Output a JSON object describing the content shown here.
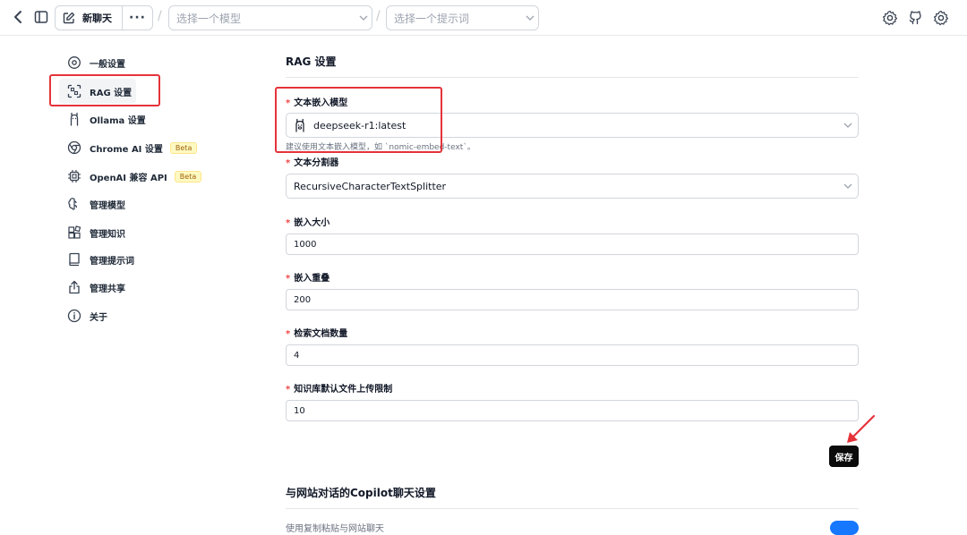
{
  "topbar": {
    "new_chat_label": "新聊天",
    "more_label": "···",
    "slash": "/",
    "model_placeholder": "选择一个模型",
    "prompt_placeholder": "选择一个提示词"
  },
  "sidebar": {
    "items": [
      {
        "label": "一般设置",
        "icon": "settings-icon"
      },
      {
        "label": "RAG 设置",
        "icon": "scan-icon"
      },
      {
        "label": "Ollama 设置",
        "icon": "llama-icon"
      },
      {
        "label": "Chrome AI 设置",
        "icon": "chrome-icon",
        "badge": "Beta"
      },
      {
        "label": "OpenAI 兼容 API",
        "icon": "cpu-icon",
        "badge": "Beta"
      },
      {
        "label": "管理模型",
        "icon": "brain-icon"
      },
      {
        "label": "管理知识",
        "icon": "blocks-icon"
      },
      {
        "label": "管理提示词",
        "icon": "book-icon"
      },
      {
        "label": "管理共享",
        "icon": "share-icon"
      },
      {
        "label": "关于",
        "icon": "info-icon"
      }
    ]
  },
  "rag": {
    "title": "RAG 设置",
    "required_mark": "*",
    "embedding_model": {
      "label": "文本嵌入模型",
      "value": "deepseek-r1:latest",
      "help": "建议使用文本嵌入模型，如 `nomic-embed-text`。"
    },
    "splitter": {
      "label": "文本分割器",
      "value": "RecursiveCharacterTextSplitter"
    },
    "chunk_size": {
      "label": "嵌入大小",
      "value": "1000"
    },
    "chunk_overlap": {
      "label": "嵌入重叠",
      "value": "200"
    },
    "doc_count": {
      "label": "检索文档数量",
      "value": "4"
    },
    "upload_limit": {
      "label": "知识库默认文件上传限制",
      "value": "10"
    },
    "save_label": "保存"
  },
  "copilot": {
    "title": "与网站对话的Copilot聊天设置",
    "first_option": "使用复制粘贴与网站聊天"
  },
  "colors": {
    "highlight": "#e5333a",
    "toggle": "#1677ff",
    "save_bg": "#0b0b0b"
  }
}
